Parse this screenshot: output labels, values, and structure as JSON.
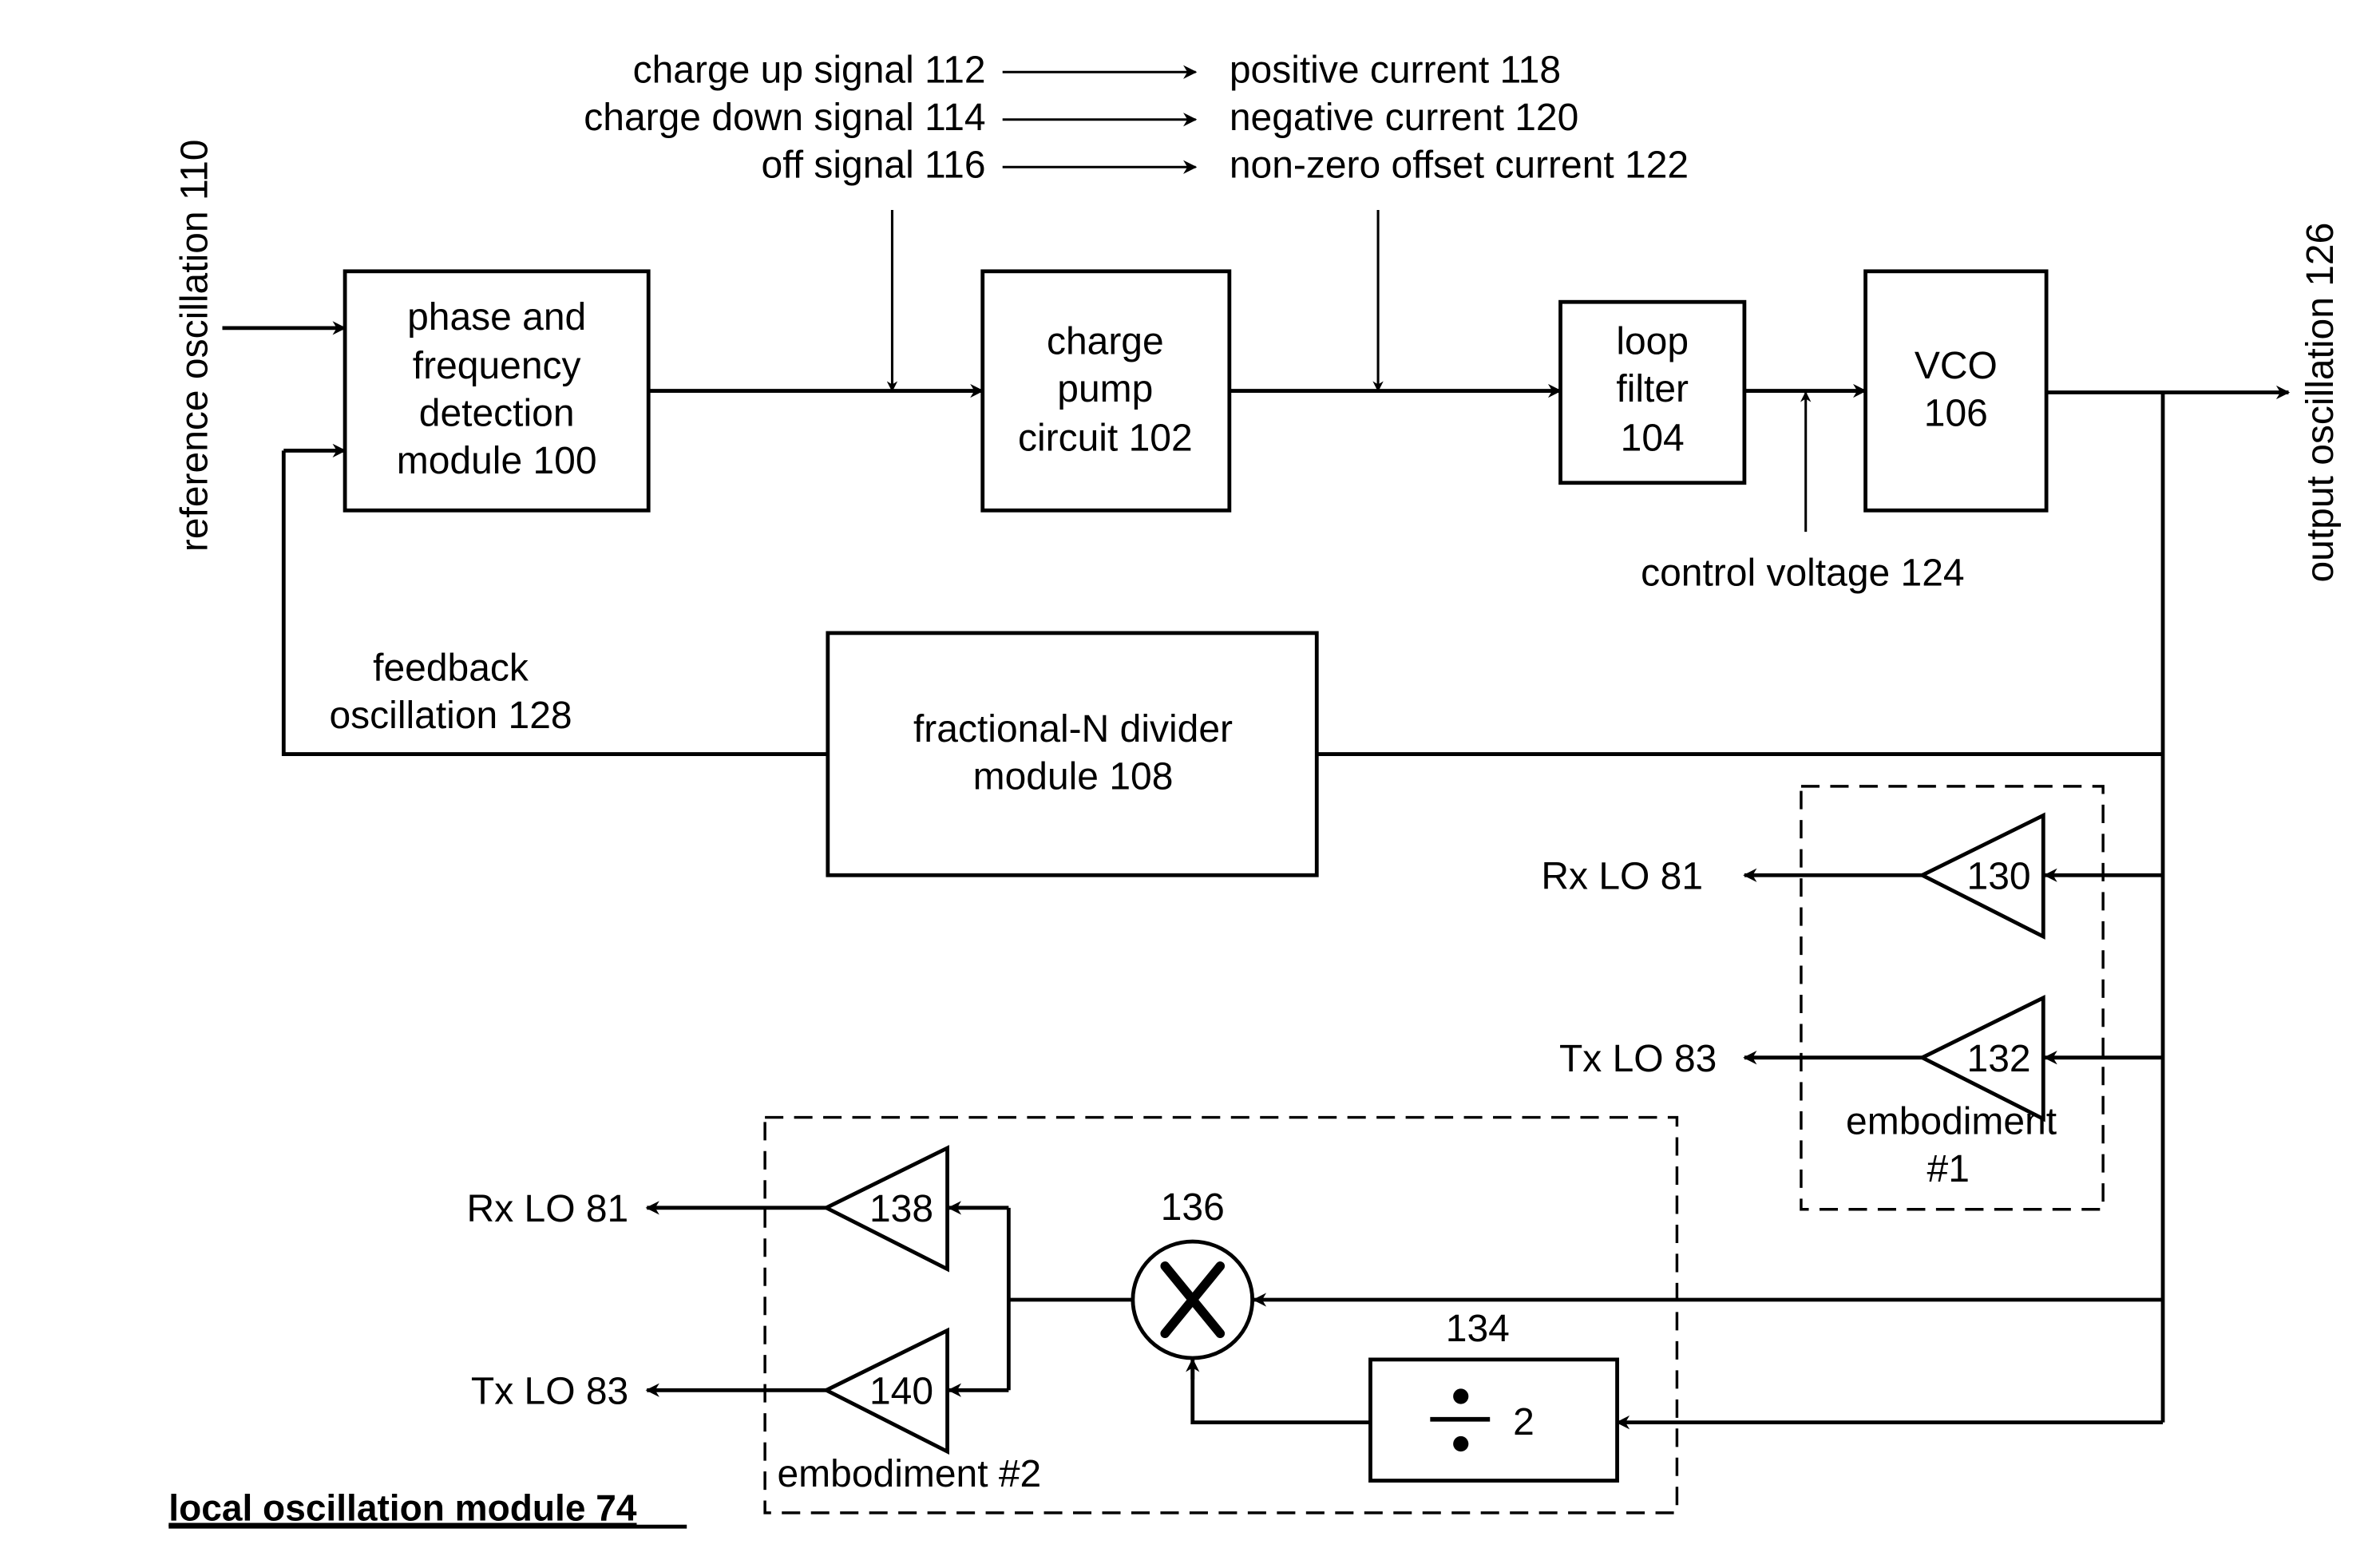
{
  "diagram": {
    "title": "local oscillation module 74",
    "signal_mapping": [
      {
        "from": "charge up signal 112",
        "to": "positive current 118"
      },
      {
        "from": "charge down signal 114",
        "to": "negative current 120"
      },
      {
        "from": "off signal 116",
        "to": "non-zero offset current 122"
      }
    ],
    "blocks": {
      "pfd": [
        "phase and",
        "frequency",
        "detection",
        "module 100"
      ],
      "charge_pump": [
        "charge",
        "pump",
        "circuit 102"
      ],
      "loop_filter": [
        "loop",
        "filter",
        "104"
      ],
      "vco": [
        "VCO",
        "106"
      ],
      "divider": [
        "fractional-N divider",
        "module 108"
      ],
      "div2_label": "134",
      "div2_text": "2",
      "mixer_label": "136"
    },
    "signals": {
      "reference": "reference oscillation 110",
      "output": "output oscillation 126",
      "control_voltage": "control voltage 124",
      "feedback": [
        "feedback",
        "oscillation 128"
      ]
    },
    "embodiment1": {
      "label": [
        "embodiment",
        "#1"
      ],
      "amps": [
        {
          "id": "130",
          "output": "Rx LO 81"
        },
        {
          "id": "132",
          "output": "Tx LO 83"
        }
      ]
    },
    "embodiment2": {
      "label": "embodiment #2",
      "amps": [
        {
          "id": "138",
          "output": "Rx LO 81"
        },
        {
          "id": "140",
          "output": "Tx LO 83"
        }
      ]
    }
  }
}
